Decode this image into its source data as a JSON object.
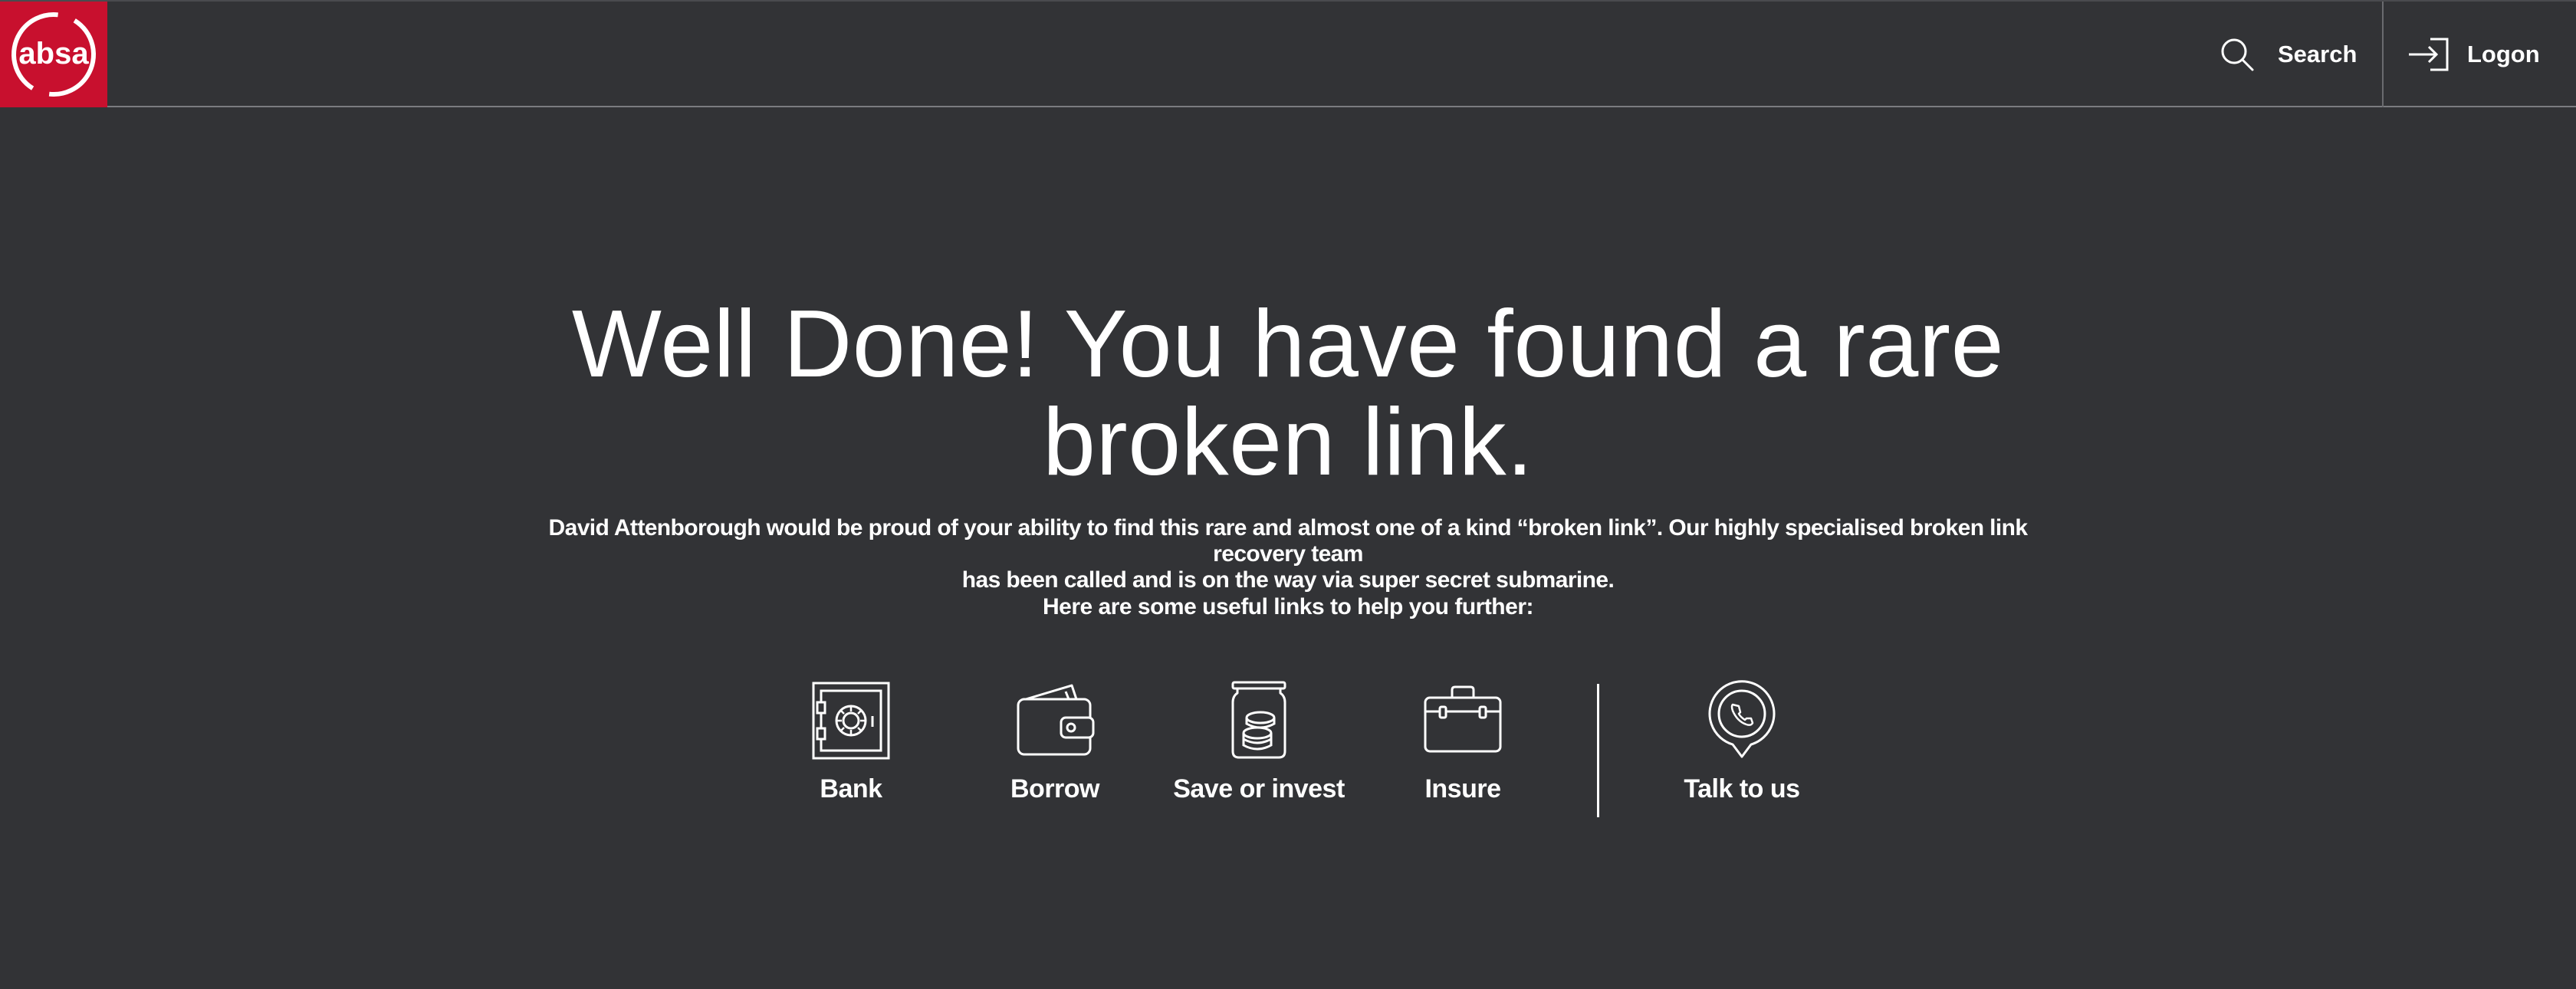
{
  "header": {
    "logo_text": "absa",
    "search_label": "Search",
    "logon_label": "Logon",
    "icons": {
      "search": "search-icon",
      "logon": "login-arrow-icon"
    }
  },
  "main": {
    "headline_line1": "Well Done! You have found a rare",
    "headline_line2": "broken link.",
    "body_line1": "David Attenborough would be proud of your ability to find this rare and almost one of a kind “broken link”. Our highly specialised broken link recovery team",
    "body_line2": "has been called and is on the way via super secret submarine.",
    "links_intro": "Here are some useful links to help you further:",
    "links": [
      {
        "label": "Bank",
        "icon": "safe-icon"
      },
      {
        "label": "Borrow",
        "icon": "wallet-icon"
      },
      {
        "label": "Save or invest",
        "icon": "coin-jar-icon"
      },
      {
        "label": "Insure",
        "icon": "briefcase-icon"
      },
      {
        "label": "Talk to us",
        "icon": "phone-pin-icon"
      }
    ]
  },
  "colors": {
    "background": "#323336",
    "brand_red": "#c8102e",
    "text": "#ffffff"
  }
}
